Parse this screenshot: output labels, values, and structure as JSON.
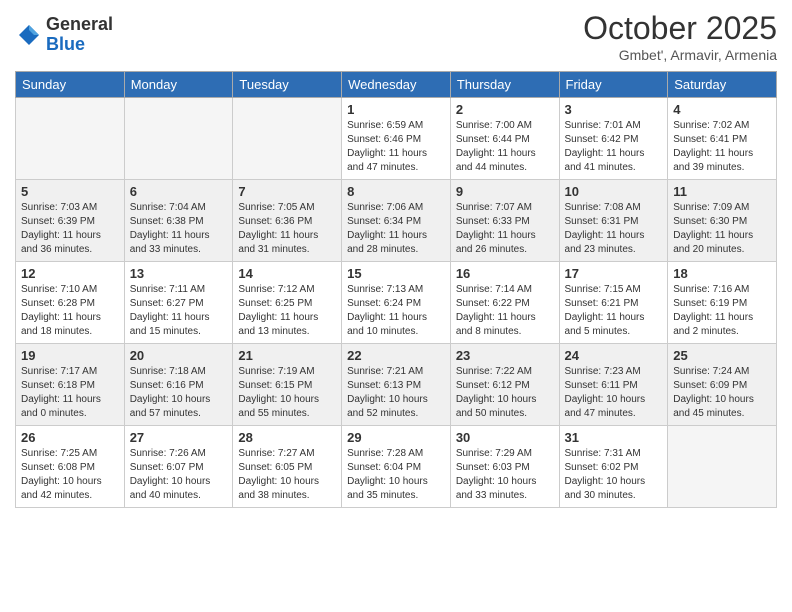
{
  "logo": {
    "general": "General",
    "blue": "Blue"
  },
  "header": {
    "month": "October 2025",
    "location": "Gmbet', Armavir, Armenia"
  },
  "days_of_week": [
    "Sunday",
    "Monday",
    "Tuesday",
    "Wednesday",
    "Thursday",
    "Friday",
    "Saturday"
  ],
  "weeks": [
    [
      {
        "day": "",
        "info": ""
      },
      {
        "day": "",
        "info": ""
      },
      {
        "day": "",
        "info": ""
      },
      {
        "day": "1",
        "info": "Sunrise: 6:59 AM\nSunset: 6:46 PM\nDaylight: 11 hours\nand 47 minutes."
      },
      {
        "day": "2",
        "info": "Sunrise: 7:00 AM\nSunset: 6:44 PM\nDaylight: 11 hours\nand 44 minutes."
      },
      {
        "day": "3",
        "info": "Sunrise: 7:01 AM\nSunset: 6:42 PM\nDaylight: 11 hours\nand 41 minutes."
      },
      {
        "day": "4",
        "info": "Sunrise: 7:02 AM\nSunset: 6:41 PM\nDaylight: 11 hours\nand 39 minutes."
      }
    ],
    [
      {
        "day": "5",
        "info": "Sunrise: 7:03 AM\nSunset: 6:39 PM\nDaylight: 11 hours\nand 36 minutes."
      },
      {
        "day": "6",
        "info": "Sunrise: 7:04 AM\nSunset: 6:38 PM\nDaylight: 11 hours\nand 33 minutes."
      },
      {
        "day": "7",
        "info": "Sunrise: 7:05 AM\nSunset: 6:36 PM\nDaylight: 11 hours\nand 31 minutes."
      },
      {
        "day": "8",
        "info": "Sunrise: 7:06 AM\nSunset: 6:34 PM\nDaylight: 11 hours\nand 28 minutes."
      },
      {
        "day": "9",
        "info": "Sunrise: 7:07 AM\nSunset: 6:33 PM\nDaylight: 11 hours\nand 26 minutes."
      },
      {
        "day": "10",
        "info": "Sunrise: 7:08 AM\nSunset: 6:31 PM\nDaylight: 11 hours\nand 23 minutes."
      },
      {
        "day": "11",
        "info": "Sunrise: 7:09 AM\nSunset: 6:30 PM\nDaylight: 11 hours\nand 20 minutes."
      }
    ],
    [
      {
        "day": "12",
        "info": "Sunrise: 7:10 AM\nSunset: 6:28 PM\nDaylight: 11 hours\nand 18 minutes."
      },
      {
        "day": "13",
        "info": "Sunrise: 7:11 AM\nSunset: 6:27 PM\nDaylight: 11 hours\nand 15 minutes."
      },
      {
        "day": "14",
        "info": "Sunrise: 7:12 AM\nSunset: 6:25 PM\nDaylight: 11 hours\nand 13 minutes."
      },
      {
        "day": "15",
        "info": "Sunrise: 7:13 AM\nSunset: 6:24 PM\nDaylight: 11 hours\nand 10 minutes."
      },
      {
        "day": "16",
        "info": "Sunrise: 7:14 AM\nSunset: 6:22 PM\nDaylight: 11 hours\nand 8 minutes."
      },
      {
        "day": "17",
        "info": "Sunrise: 7:15 AM\nSunset: 6:21 PM\nDaylight: 11 hours\nand 5 minutes."
      },
      {
        "day": "18",
        "info": "Sunrise: 7:16 AM\nSunset: 6:19 PM\nDaylight: 11 hours\nand 2 minutes."
      }
    ],
    [
      {
        "day": "19",
        "info": "Sunrise: 7:17 AM\nSunset: 6:18 PM\nDaylight: 11 hours\nand 0 minutes."
      },
      {
        "day": "20",
        "info": "Sunrise: 7:18 AM\nSunset: 6:16 PM\nDaylight: 10 hours\nand 57 minutes."
      },
      {
        "day": "21",
        "info": "Sunrise: 7:19 AM\nSunset: 6:15 PM\nDaylight: 10 hours\nand 55 minutes."
      },
      {
        "day": "22",
        "info": "Sunrise: 7:21 AM\nSunset: 6:13 PM\nDaylight: 10 hours\nand 52 minutes."
      },
      {
        "day": "23",
        "info": "Sunrise: 7:22 AM\nSunset: 6:12 PM\nDaylight: 10 hours\nand 50 minutes."
      },
      {
        "day": "24",
        "info": "Sunrise: 7:23 AM\nSunset: 6:11 PM\nDaylight: 10 hours\nand 47 minutes."
      },
      {
        "day": "25",
        "info": "Sunrise: 7:24 AM\nSunset: 6:09 PM\nDaylight: 10 hours\nand 45 minutes."
      }
    ],
    [
      {
        "day": "26",
        "info": "Sunrise: 7:25 AM\nSunset: 6:08 PM\nDaylight: 10 hours\nand 42 minutes."
      },
      {
        "day": "27",
        "info": "Sunrise: 7:26 AM\nSunset: 6:07 PM\nDaylight: 10 hours\nand 40 minutes."
      },
      {
        "day": "28",
        "info": "Sunrise: 7:27 AM\nSunset: 6:05 PM\nDaylight: 10 hours\nand 38 minutes."
      },
      {
        "day": "29",
        "info": "Sunrise: 7:28 AM\nSunset: 6:04 PM\nDaylight: 10 hours\nand 35 minutes."
      },
      {
        "day": "30",
        "info": "Sunrise: 7:29 AM\nSunset: 6:03 PM\nDaylight: 10 hours\nand 33 minutes."
      },
      {
        "day": "31",
        "info": "Sunrise: 7:31 AM\nSunset: 6:02 PM\nDaylight: 10 hours\nand 30 minutes."
      },
      {
        "day": "",
        "info": ""
      }
    ]
  ]
}
